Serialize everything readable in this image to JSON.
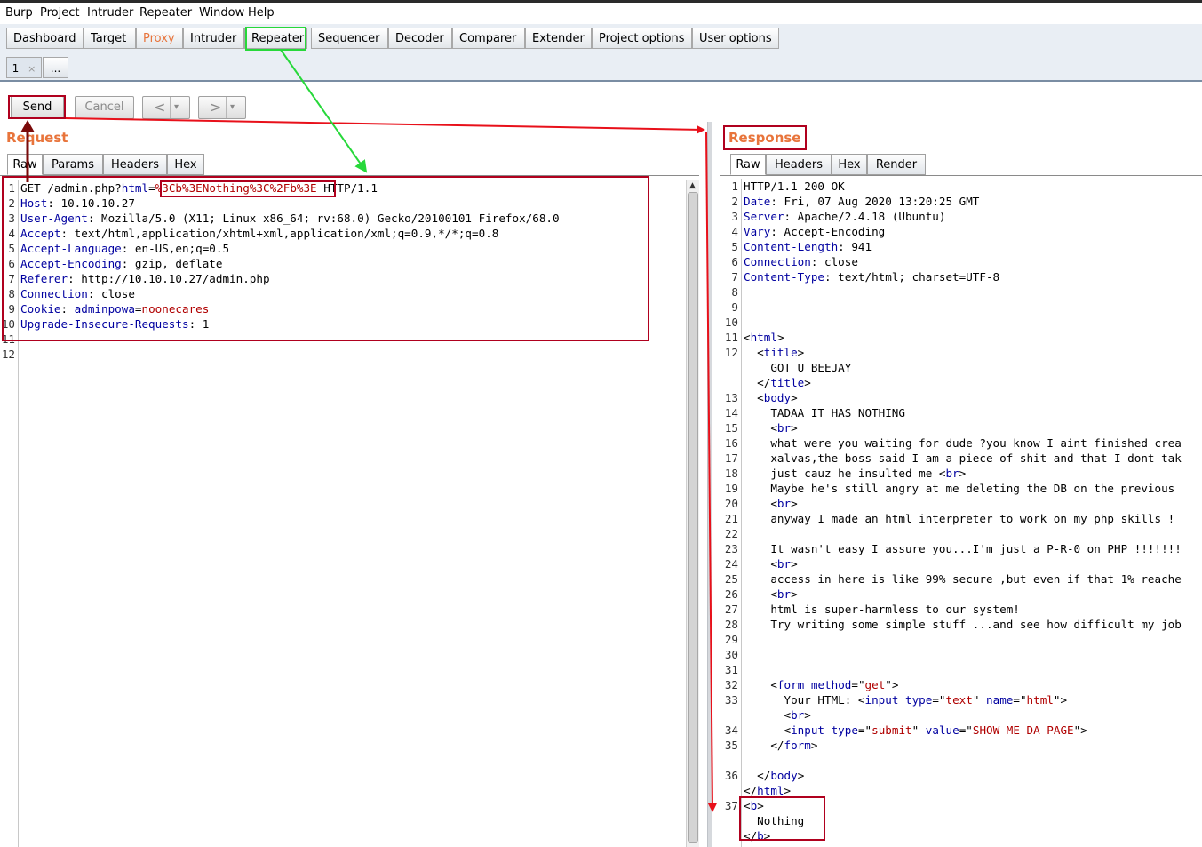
{
  "menu": [
    "Burp",
    "Project",
    "Intruder",
    "Repeater",
    "Window",
    "Help"
  ],
  "tools": [
    "Dashboard",
    "Target",
    "Proxy",
    "Intruder",
    "Repeater",
    "Sequencer",
    "Decoder",
    "Comparer",
    "Extender",
    "Project options",
    "User options"
  ],
  "repeater_tabs": {
    "tab1": "1",
    "close": "×",
    "more": "..."
  },
  "controls": {
    "send": "Send",
    "cancel": "Cancel",
    "back": "<",
    "forward": ">",
    "dropdown": "▾"
  },
  "request": {
    "title": "Request",
    "tabs": [
      "Raw",
      "Params",
      "Headers",
      "Hex"
    ],
    "lines": [
      {
        "n": "1",
        "parts": [
          [
            "GET /admin.php?",
            ""
          ],
          [
            "html",
            "k"
          ],
          [
            "=",
            ""
          ],
          [
            "%3Cb%3ENothing%3C%2Fb%3E",
            "v"
          ],
          [
            " HTTP/1.1",
            ""
          ]
        ]
      },
      {
        "n": "2",
        "parts": [
          [
            "Host",
            "k"
          ],
          [
            ": 10.10.10.27",
            ""
          ]
        ]
      },
      {
        "n": "3",
        "parts": [
          [
            "User-Agent",
            "k"
          ],
          [
            ": Mozilla/5.0 (X11; Linux x86_64; rv:68.0) Gecko/20100101 Firefox/68.0",
            ""
          ]
        ]
      },
      {
        "n": "4",
        "parts": [
          [
            "Accept",
            "k"
          ],
          [
            ": text/html,application/xhtml+xml,application/xml;q=0.9,*/*;q=0.8",
            ""
          ]
        ]
      },
      {
        "n": "5",
        "parts": [
          [
            "Accept-Language",
            "k"
          ],
          [
            ": en-US,en;q=0.5",
            ""
          ]
        ]
      },
      {
        "n": "6",
        "parts": [
          [
            "Accept-Encoding",
            "k"
          ],
          [
            ": gzip, deflate",
            ""
          ]
        ]
      },
      {
        "n": "7",
        "parts": [
          [
            "Referer",
            "k"
          ],
          [
            ": http://10.10.10.27/admin.php",
            ""
          ]
        ]
      },
      {
        "n": "8",
        "parts": [
          [
            "Connection",
            "k"
          ],
          [
            ": close",
            ""
          ]
        ]
      },
      {
        "n": "9",
        "parts": [
          [
            "Cookie",
            "k"
          ],
          [
            ": ",
            ""
          ],
          [
            "adminpowa",
            "k"
          ],
          [
            "=",
            ""
          ],
          [
            "noonecares",
            "v"
          ]
        ]
      },
      {
        "n": "10",
        "parts": [
          [
            "Upgrade-Insecure-Requests",
            "k"
          ],
          [
            ": 1",
            ""
          ]
        ]
      },
      {
        "n": "11",
        "parts": []
      },
      {
        "n": "12",
        "parts": []
      }
    ]
  },
  "response": {
    "title": "Response",
    "tabs": [
      "Raw",
      "Headers",
      "Hex",
      "Render"
    ],
    "lines": [
      {
        "n": "1",
        "parts": [
          [
            "HTTP/1.1 200 OK",
            ""
          ]
        ]
      },
      {
        "n": "2",
        "parts": [
          [
            "Date",
            "k"
          ],
          [
            ": Fri, 07 Aug 2020 13:20:25 GMT",
            ""
          ]
        ]
      },
      {
        "n": "3",
        "parts": [
          [
            "Server",
            "k"
          ],
          [
            ": Apache/2.4.18 (Ubuntu)",
            ""
          ]
        ]
      },
      {
        "n": "4",
        "parts": [
          [
            "Vary",
            "k"
          ],
          [
            ": Accept-Encoding",
            ""
          ]
        ]
      },
      {
        "n": "5",
        "parts": [
          [
            "Content-Length",
            "k"
          ],
          [
            ": 941",
            ""
          ]
        ]
      },
      {
        "n": "6",
        "parts": [
          [
            "Connection",
            "k"
          ],
          [
            ": close",
            ""
          ]
        ]
      },
      {
        "n": "7",
        "parts": [
          [
            "Content-Type",
            "k"
          ],
          [
            ": text/html; charset=UTF-8",
            ""
          ]
        ]
      },
      {
        "n": "8",
        "parts": []
      },
      {
        "n": "9",
        "parts": []
      },
      {
        "n": "10",
        "parts": []
      },
      {
        "n": "11",
        "parts": [
          [
            "<",
            ""
          ],
          [
            "html",
            "k"
          ],
          [
            ">",
            ""
          ]
        ]
      },
      {
        "n": "12",
        "parts": [
          [
            "  <",
            ""
          ],
          [
            "title",
            "k"
          ],
          [
            ">",
            ""
          ]
        ]
      },
      {
        "n": "",
        "parts": [
          [
            "    GOT U BEEJAY",
            ""
          ]
        ]
      },
      {
        "n": "",
        "parts": [
          [
            "  </",
            ""
          ],
          [
            "title",
            "k"
          ],
          [
            ">",
            ""
          ]
        ]
      },
      {
        "n": "13",
        "parts": [
          [
            "  <",
            ""
          ],
          [
            "body",
            "k"
          ],
          [
            ">",
            ""
          ]
        ]
      },
      {
        "n": "14",
        "parts": [
          [
            "    TADAA IT HAS NOTHING",
            ""
          ]
        ]
      },
      {
        "n": "15",
        "parts": [
          [
            "    <",
            ""
          ],
          [
            "br",
            "k"
          ],
          [
            ">",
            ""
          ]
        ]
      },
      {
        "n": "16",
        "parts": [
          [
            "    what were you waiting for dude ?you know I aint finished crea",
            ""
          ]
        ]
      },
      {
        "n": "17",
        "parts": [
          [
            "    xalvas,the boss said I am a piece of shit and that I dont tak",
            ""
          ]
        ]
      },
      {
        "n": "18",
        "parts": [
          [
            "    just cauz he insulted me <",
            ""
          ],
          [
            "br",
            "k"
          ],
          [
            ">",
            ""
          ]
        ]
      },
      {
        "n": "19",
        "parts": [
          [
            "    Maybe he's still angry at me deleting the DB on the previous",
            ""
          ]
        ]
      },
      {
        "n": "20",
        "parts": [
          [
            "    <",
            ""
          ],
          [
            "br",
            "k"
          ],
          [
            ">",
            ""
          ]
        ]
      },
      {
        "n": "21",
        "parts": [
          [
            "    anyway I made an html interpreter to work on my php skills !",
            ""
          ]
        ]
      },
      {
        "n": "22",
        "parts": []
      },
      {
        "n": "23",
        "parts": [
          [
            "    It wasn't easy I assure you...I'm just a P-R-0 on PHP !!!!!!!",
            ""
          ]
        ]
      },
      {
        "n": "24",
        "parts": [
          [
            "    <",
            ""
          ],
          [
            "br",
            "k"
          ],
          [
            ">",
            ""
          ]
        ]
      },
      {
        "n": "25",
        "parts": [
          [
            "    access in here is like 99% secure ,but even if that 1% reache",
            ""
          ]
        ]
      },
      {
        "n": "26",
        "parts": [
          [
            "    <",
            ""
          ],
          [
            "br",
            "k"
          ],
          [
            ">",
            ""
          ]
        ]
      },
      {
        "n": "27",
        "parts": [
          [
            "    html is super-harmless to our system!",
            ""
          ]
        ]
      },
      {
        "n": "28",
        "parts": [
          [
            "    Try writing some simple stuff ...and see how difficult my job",
            ""
          ]
        ]
      },
      {
        "n": "29",
        "parts": []
      },
      {
        "n": "30",
        "parts": []
      },
      {
        "n": "31",
        "parts": []
      },
      {
        "n": "32",
        "parts": [
          [
            "    <",
            ""
          ],
          [
            "form",
            "k"
          ],
          [
            " ",
            ""
          ],
          [
            "method",
            "k"
          ],
          [
            "=\"",
            ""
          ],
          [
            "get",
            "v"
          ],
          [
            "\">",
            ""
          ]
        ]
      },
      {
        "n": "33",
        "parts": [
          [
            "      Your HTML: <",
            ""
          ],
          [
            "input",
            "k"
          ],
          [
            " ",
            ""
          ],
          [
            "type",
            "k"
          ],
          [
            "=\"",
            ""
          ],
          [
            "text",
            "v"
          ],
          [
            "\" ",
            ""
          ],
          [
            "name",
            "k"
          ],
          [
            "=\"",
            ""
          ],
          [
            "html",
            "v"
          ],
          [
            "\">",
            ""
          ]
        ]
      },
      {
        "n": "",
        "parts": [
          [
            "      <",
            ""
          ],
          [
            "br",
            "k"
          ],
          [
            ">",
            ""
          ]
        ]
      },
      {
        "n": "34",
        "parts": [
          [
            "      <",
            ""
          ],
          [
            "input",
            "k"
          ],
          [
            " ",
            ""
          ],
          [
            "type",
            "k"
          ],
          [
            "=\"",
            ""
          ],
          [
            "submit",
            "v"
          ],
          [
            "\" ",
            ""
          ],
          [
            "value",
            "k"
          ],
          [
            "=\"",
            ""
          ],
          [
            "SHOW ME DA PAGE",
            "v"
          ],
          [
            "\">",
            ""
          ]
        ]
      },
      {
        "n": "35",
        "parts": [
          [
            "    </",
            ""
          ],
          [
            "form",
            "k"
          ],
          [
            ">",
            ""
          ]
        ]
      },
      {
        "n": "",
        "parts": []
      },
      {
        "n": "36",
        "parts": [
          [
            "  </",
            ""
          ],
          [
            "body",
            "k"
          ],
          [
            ">",
            ""
          ]
        ]
      },
      {
        "n": "",
        "parts": [
          [
            "</",
            ""
          ],
          [
            "html",
            "k"
          ],
          [
            ">",
            ""
          ]
        ]
      },
      {
        "n": "37",
        "parts": [
          [
            "<",
            ""
          ],
          [
            "b",
            "k"
          ],
          [
            ">",
            ""
          ]
        ]
      },
      {
        "n": "",
        "parts": [
          [
            "  Nothing",
            ""
          ]
        ]
      },
      {
        "n": "",
        "parts": [
          [
            "</",
            ""
          ],
          [
            "b",
            "k"
          ],
          [
            ">",
            ""
          ]
        ]
      }
    ]
  },
  "colors": {
    "accent": "#e8743b",
    "annotation_red": "#b0001e",
    "annotation_green": "#27d83a",
    "arrow_red": "#e8101a",
    "arrow_dark": "#7a0a0a"
  }
}
